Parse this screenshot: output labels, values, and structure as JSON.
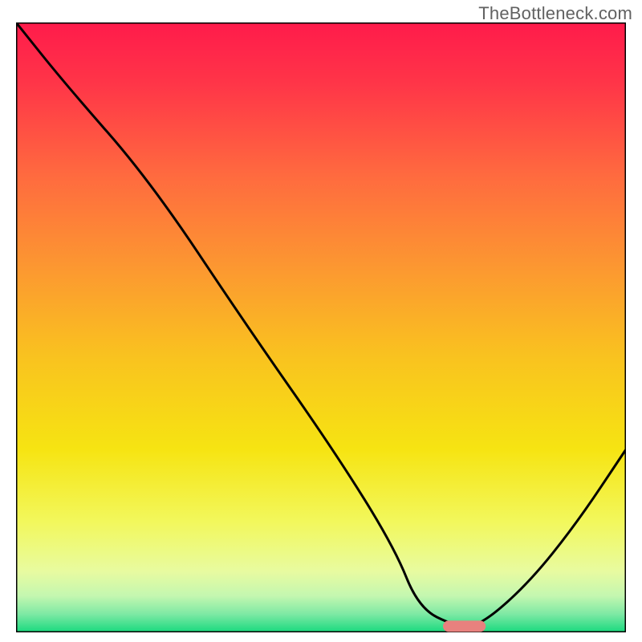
{
  "watermark": "TheBottleneck.com",
  "chart_data": {
    "type": "line",
    "title": "",
    "xlabel": "",
    "ylabel": "",
    "xlim": [
      0,
      100
    ],
    "ylim": [
      0,
      100
    ],
    "background_gradient_stops": [
      {
        "offset": 0.0,
        "color": "#ff1b4b"
      },
      {
        "offset": 0.1,
        "color": "#ff3548"
      },
      {
        "offset": 0.25,
        "color": "#ff6a3f"
      },
      {
        "offset": 0.4,
        "color": "#fc9731"
      },
      {
        "offset": 0.55,
        "color": "#f9c31f"
      },
      {
        "offset": 0.7,
        "color": "#f6e412"
      },
      {
        "offset": 0.82,
        "color": "#f2f85d"
      },
      {
        "offset": 0.9,
        "color": "#e8fba0"
      },
      {
        "offset": 0.94,
        "color": "#c4f7b0"
      },
      {
        "offset": 0.97,
        "color": "#7ee9a4"
      },
      {
        "offset": 1.0,
        "color": "#18d97e"
      }
    ],
    "curve": {
      "x": [
        0,
        8,
        22,
        38,
        52,
        62,
        66,
        72,
        76,
        84,
        92,
        100
      ],
      "y": [
        100,
        90,
        74,
        50,
        30,
        14,
        4,
        1,
        1,
        8,
        18,
        30
      ]
    },
    "bottom_marker": {
      "x_start": 70,
      "x_end": 77,
      "y": 1,
      "color": "#e8817e"
    }
  }
}
